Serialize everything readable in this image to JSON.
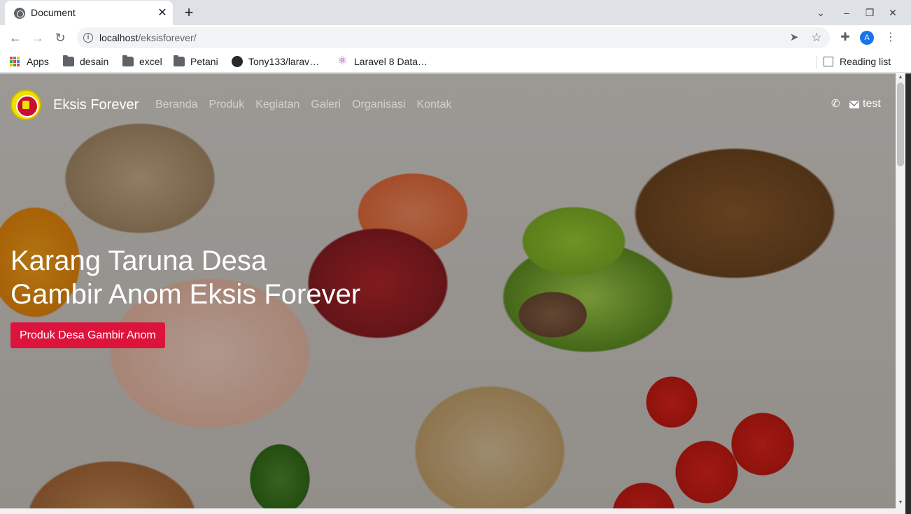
{
  "browser": {
    "tab": {
      "title": "Document",
      "close_glyph": "✕",
      "icon": "globe-icon"
    },
    "new_tab_glyph": "+",
    "window_controls": {
      "tab_search": "⌄",
      "minimize": "–",
      "restore": "❐",
      "close": "✕"
    },
    "toolbar": {
      "back": "←",
      "forward": "→",
      "reload": "↻",
      "url_host": "localhost",
      "url_path": "/eksisforever/",
      "send_glyph": "➤",
      "star_glyph": "☆",
      "extensions_glyph": "✚",
      "profile_initial": "A",
      "menu_glyph": "⋮"
    },
    "bookmarks": [
      {
        "label": "Apps",
        "icon": "apps-grid-icon"
      },
      {
        "label": "desain",
        "icon": "folder-icon"
      },
      {
        "label": "excel",
        "icon": "folder-icon"
      },
      {
        "label": "Petani",
        "icon": "folder-icon"
      },
      {
        "label": "Tony133/larav…",
        "icon": "github-icon"
      },
      {
        "label": "Laravel 8 Data…",
        "icon": "react-icon"
      }
    ],
    "reading_list": "Reading list"
  },
  "site": {
    "brand": "Eksis Forever",
    "nav": [
      "Beranda",
      "Produk",
      "Kegiatan",
      "Galeri",
      "Organisasi",
      "Kontak"
    ],
    "contact_label": "test",
    "phone_glyph": "✆",
    "hero_title_line1": "Karang Taruna Desa",
    "hero_title_line2": "Gambir Anom Eksis Forever",
    "cta_label": "Produk Desa Gambir Anom",
    "accent_color": "#dc143c"
  },
  "scrollbar": {
    "up": "▲",
    "down": "▼"
  }
}
